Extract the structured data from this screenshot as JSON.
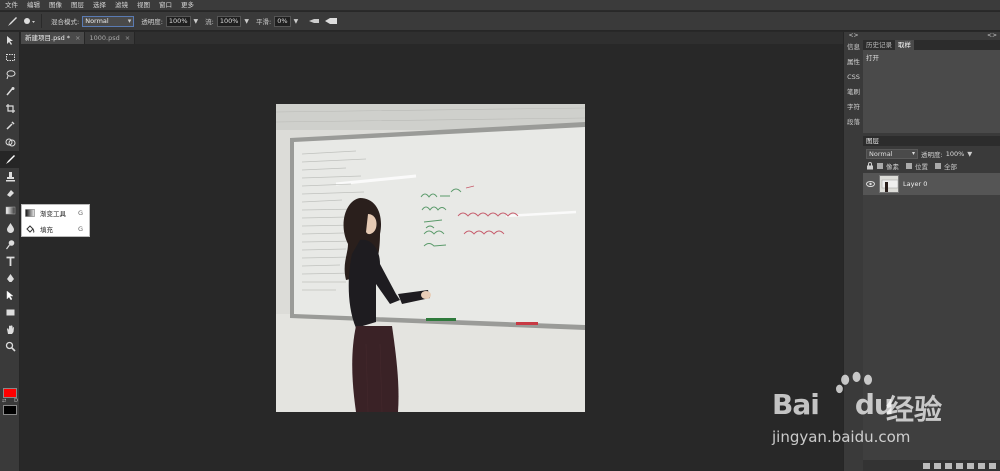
{
  "menu": [
    "文件",
    "编辑",
    "图像",
    "图层",
    "选择",
    "滤镜",
    "视图",
    "窗口",
    "更多"
  ],
  "options": {
    "blend_label": "混合模式:",
    "blend_value": "Normal",
    "opacity_label": "透明度:",
    "opacity_value": "100%",
    "flow_label": "流:",
    "flow_value": "100%",
    "smooth_label": "平滑:",
    "smooth_value": "0%"
  },
  "tabs": [
    {
      "label": "新建项目.psd *",
      "close": "×"
    },
    {
      "label": "1000.psd",
      "close": "×"
    }
  ],
  "flyout": {
    "items": [
      {
        "label": "渐变工具",
        "key": "G"
      },
      {
        "label": "填充",
        "key": "G"
      }
    ]
  },
  "toolbox": {
    "swap_a": "⇄",
    "swap_b": "D"
  },
  "right_strip": {
    "arrows": "<>",
    "items": [
      "信息",
      "属性",
      "CSS",
      "笔刷",
      "字符",
      "段落"
    ]
  },
  "panels": {
    "top_arrows": "<>",
    "history_tabs": [
      "历史记录",
      "取样"
    ],
    "history_items": [
      "打开"
    ],
    "layers_title": "图层",
    "layers_blend": "Normal",
    "layers_opacity_label": "透明度:",
    "layers_opacity_value": "100%",
    "lock_options": [
      "像素",
      "位置",
      "全部"
    ],
    "layers": [
      {
        "name": "Layer 0"
      }
    ]
  },
  "watermark": {
    "brand": "Bai",
    "brand2": "du",
    "cn": "经验",
    "url": "jingyan.baidu.com"
  },
  "colors": {
    "foreground": "#ff0000",
    "background": "#000000"
  }
}
